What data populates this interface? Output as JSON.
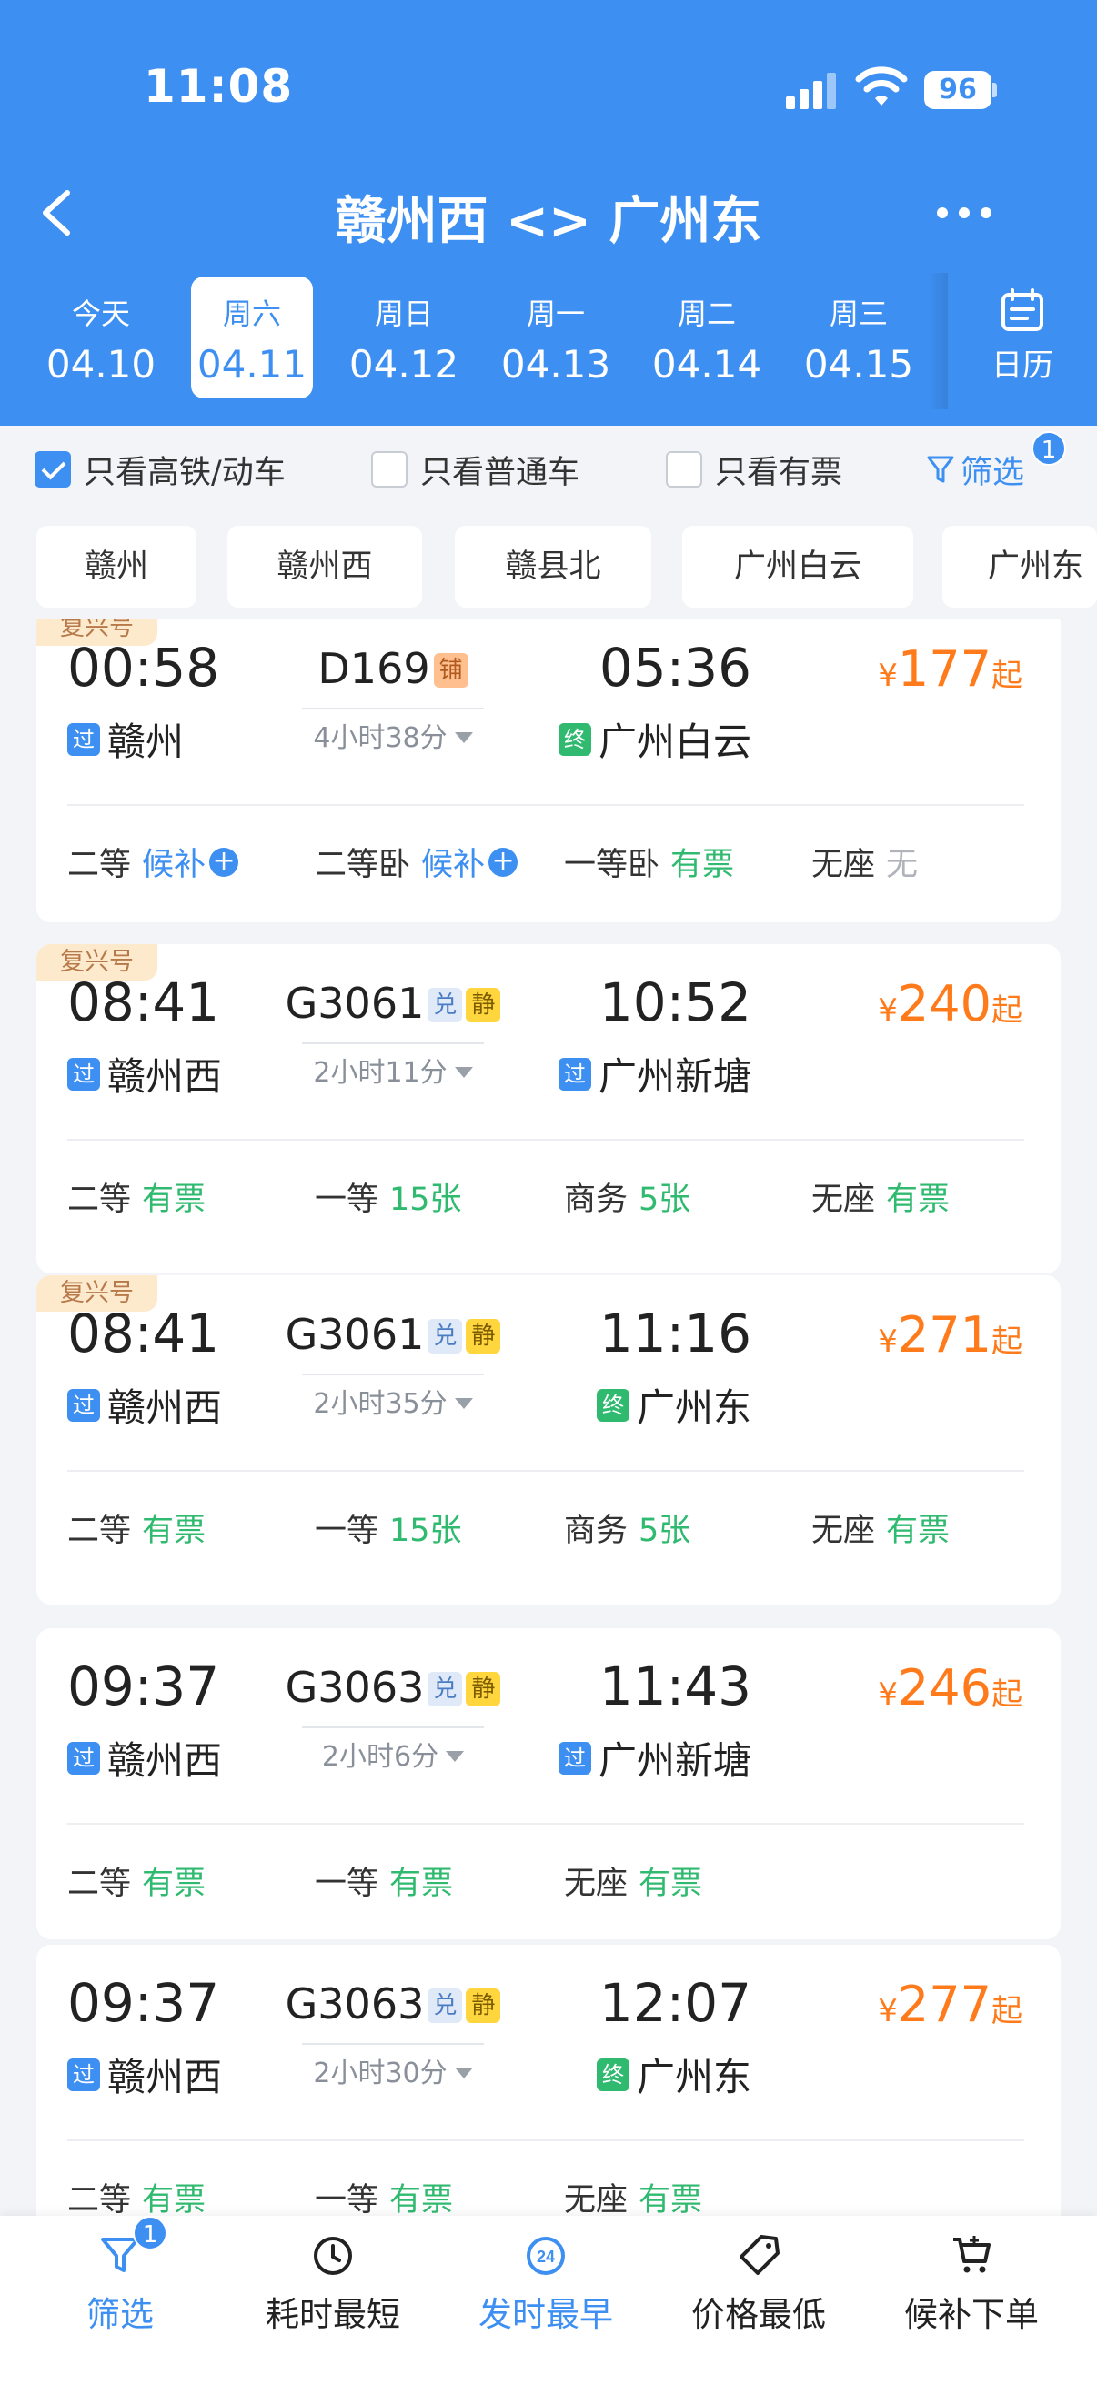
{
  "status_bar": {
    "time": "11:08",
    "battery": "96"
  },
  "header": {
    "title": "赣州西 <> 广州东",
    "dates": [
      {
        "weekday": "今天",
        "date": "04.10"
      },
      {
        "weekday": "周六",
        "date": "04.11"
      },
      {
        "weekday": "周日",
        "date": "04.12"
      },
      {
        "weekday": "周一",
        "date": "04.13"
      },
      {
        "weekday": "周二",
        "date": "04.14"
      },
      {
        "weekday": "周三",
        "date": "04.15"
      }
    ],
    "active_date_index": 1,
    "calendar_label": "日历"
  },
  "filters": {
    "only_high_speed": "只看高铁/动车",
    "only_normal": "只看普通车",
    "only_available": "只看有票",
    "filter_label": "筛选",
    "filter_count": "1"
  },
  "stations": [
    "赣州",
    "赣州西",
    "赣县北",
    "广州白云",
    "广州东"
  ],
  "trains": [
    {
      "tag": "复兴号",
      "dep_time": "00:58",
      "train_no": "D169",
      "badges": [
        "铺"
      ],
      "arr_time": "05:36",
      "duration": "4小时38分",
      "from_badge": "过",
      "from": "赣州",
      "to_badge": "终",
      "to": "广州白云",
      "price_symbol": "¥",
      "price": "177",
      "price_suffix": "起",
      "seats": [
        {
          "name": "二等",
          "status": "候补",
          "kind": "b",
          "plus": true
        },
        {
          "name": "二等卧",
          "status": "候补",
          "kind": "b",
          "plus": true
        },
        {
          "name": "一等卧",
          "status": "有票",
          "kind": "g"
        },
        {
          "name": "无座",
          "status": "无",
          "kind": "n"
        }
      ]
    },
    {
      "tag": "复兴号",
      "dep_time": "08:41",
      "train_no": "G3061",
      "badges": [
        "兑",
        "静"
      ],
      "arr_time": "10:52",
      "duration": "2小时11分",
      "from_badge": "过",
      "from": "赣州西",
      "to_badge": "过",
      "to": "广州新塘",
      "price_symbol": "¥",
      "price": "240",
      "price_suffix": "起",
      "seats": [
        {
          "name": "二等",
          "status": "有票",
          "kind": "g"
        },
        {
          "name": "一等",
          "status": "15张",
          "kind": "g"
        },
        {
          "name": "商务",
          "status": "5张",
          "kind": "g"
        },
        {
          "name": "无座",
          "status": "有票",
          "kind": "g"
        }
      ]
    },
    {
      "tag": "复兴号",
      "dep_time": "08:41",
      "train_no": "G3061",
      "badges": [
        "兑",
        "静"
      ],
      "arr_time": "11:16",
      "duration": "2小时35分",
      "from_badge": "过",
      "from": "赣州西",
      "to_badge": "终",
      "to": "广州东",
      "price_symbol": "¥",
      "price": "271",
      "price_suffix": "起",
      "seats": [
        {
          "name": "二等",
          "status": "有票",
          "kind": "g"
        },
        {
          "name": "一等",
          "status": "15张",
          "kind": "g"
        },
        {
          "name": "商务",
          "status": "5张",
          "kind": "g"
        },
        {
          "name": "无座",
          "status": "有票",
          "kind": "g"
        }
      ]
    },
    {
      "tag": "",
      "dep_time": "09:37",
      "train_no": "G3063",
      "badges": [
        "兑",
        "静"
      ],
      "arr_time": "11:43",
      "duration": "2小时6分",
      "from_badge": "过",
      "from": "赣州西",
      "to_badge": "过",
      "to": "广州新塘",
      "price_symbol": "¥",
      "price": "246",
      "price_suffix": "起",
      "seats": [
        {
          "name": "二等",
          "status": "有票",
          "kind": "g"
        },
        {
          "name": "一等",
          "status": "有票",
          "kind": "g"
        },
        {
          "name": "无座",
          "status": "有票",
          "kind": "g"
        }
      ]
    },
    {
      "tag": "",
      "dep_time": "09:37",
      "train_no": "G3063",
      "badges": [
        "兑",
        "静"
      ],
      "arr_time": "12:07",
      "duration": "2小时30分",
      "from_badge": "过",
      "from": "赣州西",
      "to_badge": "终",
      "to": "广州东",
      "price_symbol": "¥",
      "price": "277",
      "price_suffix": "起",
      "seats": [
        {
          "name": "二等",
          "status": "有票",
          "kind": "g"
        },
        {
          "name": "一等",
          "status": "有票",
          "kind": "g"
        },
        {
          "name": "无座",
          "status": "有票",
          "kind": "g"
        }
      ]
    }
  ],
  "bottom_bar": [
    {
      "label": "筛选",
      "icon": "funnel-icon",
      "badge": "1"
    },
    {
      "label": "耗时最短",
      "icon": "clock-icon"
    },
    {
      "label": "发时最早",
      "icon": "24h-icon",
      "icon_text": "24",
      "active": true
    },
    {
      "label": "价格最低",
      "icon": "price-tag-icon"
    },
    {
      "label": "候补下单",
      "icon": "cart-icon"
    }
  ],
  "colors": {
    "primary": "#3d8ff2",
    "price": "#ff7a1a",
    "available": "#2fba6f",
    "tag_bg": "#fde9cc"
  }
}
